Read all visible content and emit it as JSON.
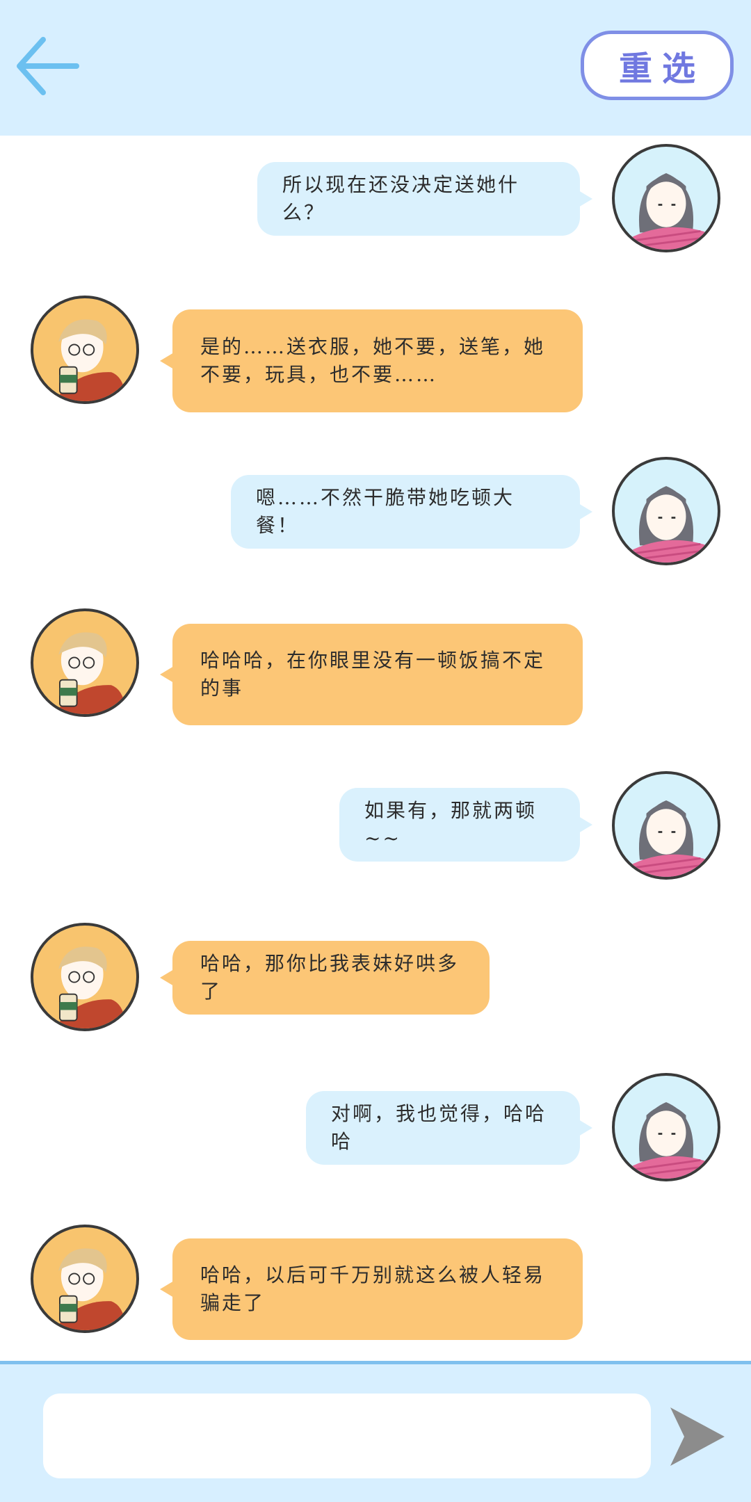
{
  "header": {
    "back_icon": "arrow-left-icon",
    "reselect_label": "重选",
    "colors": {
      "background": "#d7efff",
      "accent": "#7078e0",
      "arrow": "#6cc0f0"
    }
  },
  "messages": [
    {
      "sender": "girl",
      "text": "所以现在还没决定送她什么？"
    },
    {
      "sender": "boy",
      "text": "是的……送衣服，她不要，送笔，她不要，玩具，也不要……"
    },
    {
      "sender": "girl",
      "text": "嗯……不然干脆带她吃顿大餐！"
    },
    {
      "sender": "boy",
      "text": "哈哈哈，在你眼里没有一顿饭搞不定的事"
    },
    {
      "sender": "girl",
      "text": "如果有，那就两顿~~"
    },
    {
      "sender": "boy",
      "text": "哈哈，那你比我表妹好哄多了"
    },
    {
      "sender": "girl",
      "text": "对啊，我也觉得，哈哈哈"
    },
    {
      "sender": "boy",
      "text": "哈哈，以后可千万别就这么被人轻易骗走了"
    }
  ],
  "composer": {
    "input_value": "",
    "send_icon": "send-icon"
  },
  "colors": {
    "girl_bubble": "#daf1fd",
    "boy_bubble": "#fcc676",
    "girl_avatar_bg": "#d6f2fb",
    "boy_avatar_bg": "#f8c46e"
  }
}
